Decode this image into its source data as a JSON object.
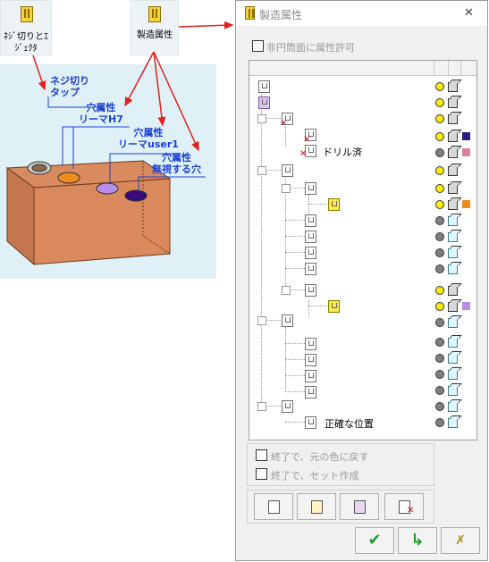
{
  "toolbar": {
    "screw_tap_label": "ﾈｼﾞ切りとｴｼﾞｪｸﾀ",
    "manufacturing_attr_label": "製造属性"
  },
  "illustration": {
    "callouts": [
      {
        "text": "ネジ切り\nタップ"
      },
      {
        "text": "穴属性\nリーマH7"
      },
      {
        "text": "穴属性\nリーマuser1"
      },
      {
        "text": "穴属性\n無視する穴"
      }
    ],
    "colors": {
      "block": "#d98a5e",
      "background": "#dff1f6",
      "hole_orange": "#f08a1e",
      "hole_lavender": "#b88de6",
      "hole_purple": "#3a0a7a",
      "arrows": "#e02020"
    }
  },
  "dialog": {
    "title": "製造属性",
    "close_icon": "close-icon",
    "allow_non_plane_label": "非円筒面に属性許可",
    "tree": {
      "drill_done_label": "ドリル済",
      "precise_position_label": "正確な位置",
      "swatch_colors": [
        "#2b1a80",
        "#d9839a",
        "#f08a1e",
        "#b88de6"
      ]
    },
    "options": {
      "restore_color_label": "終了で、元の色に戻す",
      "create_set_label": "終了で、セット作成"
    },
    "ok_icon": "check-icon",
    "apply_icon": "arrow-check-icon",
    "cancel_icon": "cancel-icon"
  }
}
